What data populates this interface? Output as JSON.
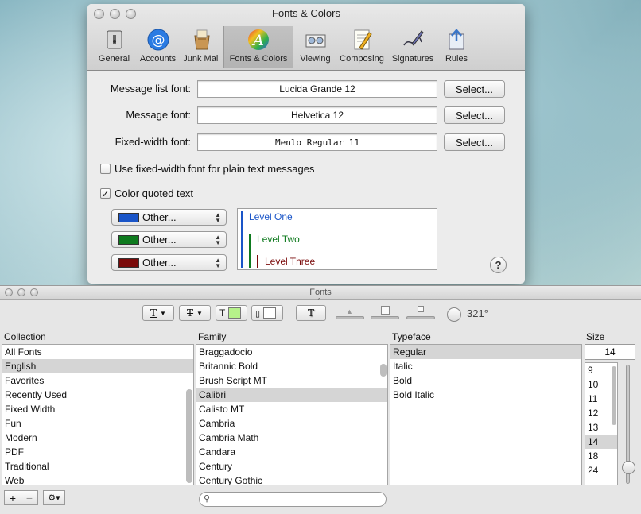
{
  "prefs": {
    "title": "Fonts & Colors",
    "toolbar": [
      {
        "label": "General",
        "icon": "general-icon"
      },
      {
        "label": "Accounts",
        "icon": "accounts-icon"
      },
      {
        "label": "Junk Mail",
        "icon": "junk-mail-icon"
      },
      {
        "label": "Fonts & Colors",
        "icon": "fonts-colors-icon",
        "selected": true
      },
      {
        "label": "Viewing",
        "icon": "viewing-icon"
      },
      {
        "label": "Composing",
        "icon": "composing-icon"
      },
      {
        "label": "Signatures",
        "icon": "signatures-icon"
      },
      {
        "label": "Rules",
        "icon": "rules-icon"
      }
    ],
    "message_list_font": {
      "label": "Message list font:",
      "value": "Lucida Grande 12"
    },
    "message_font": {
      "label": "Message font:",
      "value": "Helvetica 12"
    },
    "fixed_width_font": {
      "label": "Fixed-width font:",
      "value": "Menlo Regular 11"
    },
    "select_label": "Select...",
    "use_fixed_width": {
      "label": "Use fixed-width font for plain text messages",
      "checked": false
    },
    "color_quoted": {
      "label": "Color quoted text",
      "checked": true
    },
    "color_popups": [
      {
        "label": "Other...",
        "color": "#1a55c8"
      },
      {
        "label": "Other...",
        "color": "#0e7a1e"
      },
      {
        "label": "Other...",
        "color": "#7a0a0a"
      }
    ],
    "quote_levels": [
      {
        "label": "Level One",
        "color": "#1a55c8"
      },
      {
        "label": "Level Two",
        "color": "#0e7a1e"
      },
      {
        "label": "Level Three",
        "color": "#7a0a0a"
      }
    ],
    "help_label": "?"
  },
  "fonts_panel": {
    "title": "Fonts",
    "rotation": "321°",
    "text_color": "#b6f28a",
    "headers": {
      "collection": "Collection",
      "family": "Family",
      "typeface": "Typeface",
      "size": "Size"
    },
    "collections": [
      "All Fonts",
      "English",
      "Favorites",
      "Recently Used",
      "Fixed Width",
      "Fun",
      "Modern",
      "PDF",
      "Traditional",
      "Web"
    ],
    "selected_collection": "English",
    "families": [
      "Braggadocio",
      "Britannic Bold",
      "Brush Script MT",
      "Calibri",
      "Calisto MT",
      "Cambria",
      "Cambria Math",
      "Candara",
      "Century",
      "Century Gothic"
    ],
    "selected_family": "Calibri",
    "typefaces": [
      "Regular",
      "Italic",
      "Bold",
      "Bold Italic"
    ],
    "selected_typeface": "Regular",
    "size_value": "14",
    "sizes": [
      "9",
      "10",
      "11",
      "12",
      "13",
      "14",
      "18",
      "24"
    ],
    "selected_size": "14",
    "search_placeholder": ""
  }
}
